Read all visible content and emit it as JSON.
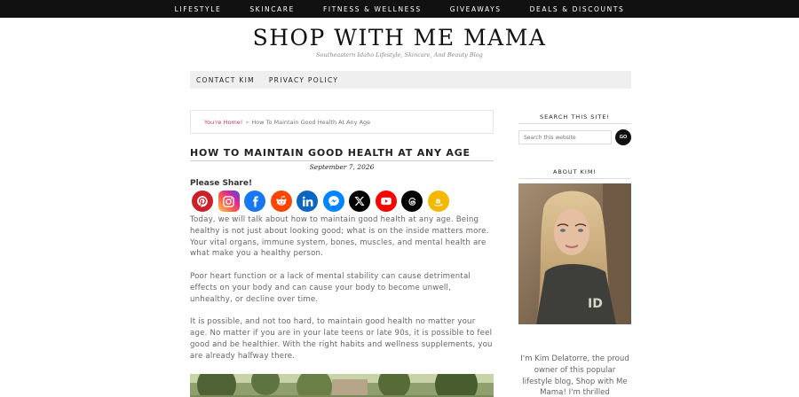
{
  "top_nav": [
    "LIFESTYLE",
    "SKINCARE",
    "FITNESS & WELLNESS",
    "GIVEAWAYS",
    "DEALS & DISCOUNTS"
  ],
  "site": {
    "title": "SHOP WITH ME MAMA",
    "description": "Southeastern Idaho Lifestyle, Skincare, And Beauty Blog"
  },
  "secondary_nav": [
    "CONTACT KIM",
    "PRIVACY POLICY"
  ],
  "breadcrumb": {
    "home": "You're Home!",
    "separator": "»",
    "current": "How To Maintain Good Health At Any Age"
  },
  "post": {
    "title": "HOW TO MAINTAIN GOOD HEALTH AT ANY AGE",
    "date": "September 7, 2026",
    "share_label": "Please Share!",
    "paragraphs": [
      "Today, we will talk about how to maintain good health at any age. Being healthy is not just about looking good; what is on the inside matters more. Your vital organs, immune system, bones, muscles, and mental health are what make you a healthy person.",
      "Poor heart function or a lack of mental stability can cause detrimental effects on your body and can cause your body to become unwell, unhealthy, or decline over time.",
      "It is possible, and not too hard, to maintain good health no matter your age. No matter if you are in your late teens or late 90s, it is possible to feel good and be healthier. With the right habits and wellness supplements, you are already halfway there."
    ]
  },
  "share_buttons": [
    {
      "name": "pinterest",
      "icon": "pinterest-icon",
      "color": "#cb2027"
    },
    {
      "name": "instagram",
      "icon": "instagram-icon",
      "color": "#d6249f"
    },
    {
      "name": "facebook",
      "icon": "facebook-icon",
      "color": "#1877f2"
    },
    {
      "name": "reddit",
      "icon": "reddit-icon",
      "color": "#ff4500"
    },
    {
      "name": "linkedin",
      "icon": "linkedin-icon",
      "color": "#0a66c2"
    },
    {
      "name": "messenger",
      "icon": "messenger-icon",
      "color": "#0084ff"
    },
    {
      "name": "x",
      "icon": "x-icon",
      "color": "#000000"
    },
    {
      "name": "youtube",
      "icon": "youtube-icon",
      "color": "#ff0000"
    },
    {
      "name": "threads",
      "icon": "threads-icon",
      "color": "#000000"
    },
    {
      "name": "amazon",
      "icon": "amazon-icon",
      "color": "#f5b800"
    }
  ],
  "sidebar": {
    "search_title": "SEARCH THIS SITE!",
    "search_placeholder": "Search this website",
    "search_button": "GO",
    "about_title": "ABOUT KIM!",
    "about_text": "I'm Kim Delatorre, the proud owner of this popular lifestyle blog, Shop with Me Mama! I'm thrilled"
  },
  "colors": {
    "top_nav_bg": "#111111",
    "breadcrumb_link": "#c43d6a",
    "secondary_nav_bg": "#efefef"
  }
}
